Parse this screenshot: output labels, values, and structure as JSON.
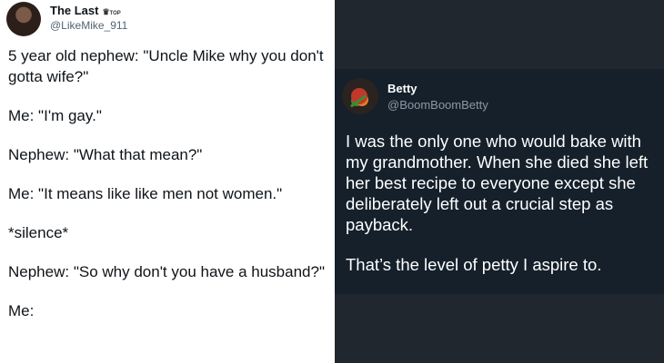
{
  "left_tweet": {
    "author_name": "The Last",
    "badge_text": "TOP",
    "handle": "@LikeMike_911",
    "lines": [
      "5 year old nephew: \"Uncle Mike why you don't gotta wife?\"",
      "Me: \"I'm gay.\"",
      "Nephew: \"What that mean?\"",
      "Me: \"It means like like men not women.\"",
      "*silence*",
      "Nephew: \"So why don't you have a husband?\"",
      "Me:"
    ]
  },
  "right_tweet": {
    "author_name": "Betty",
    "handle": "@BoomBoomBetty",
    "paragraphs": [
      "I was the only one who would bake with my grandmother. When she died she left her best recipe to everyone except she deliberately left out a crucial step as payback.",
      "That’s the level of petty I aspire to."
    ]
  },
  "colors": {
    "left_bg": "#ffffff",
    "right_bg": "#20272f",
    "card_bg": "#15202b",
    "handle_gray": "#536471"
  }
}
